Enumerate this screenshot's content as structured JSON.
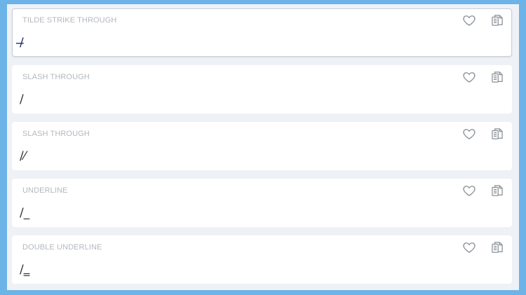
{
  "styles": [
    {
      "label": "TILDE STRIKE THROUGH",
      "value": "/̶",
      "selected": true
    },
    {
      "label": "SLASH THROUGH",
      "value": "/",
      "selected": false
    },
    {
      "label": "SLASH THROUGH",
      "value": "/⁄",
      "selected": false
    },
    {
      "label": "UNDERLINE",
      "value": "/_",
      "selected": false
    },
    {
      "label": "DOUBLE UNDERLINE",
      "value": "/‗",
      "selected": false
    }
  ],
  "icons": {
    "favorite": "heart-icon",
    "copy": "copy-icon"
  },
  "colors": {
    "frame": "#6cb3e8",
    "background": "#eef1f6",
    "card": "#ffffff",
    "label": "#b3b8bf"
  }
}
